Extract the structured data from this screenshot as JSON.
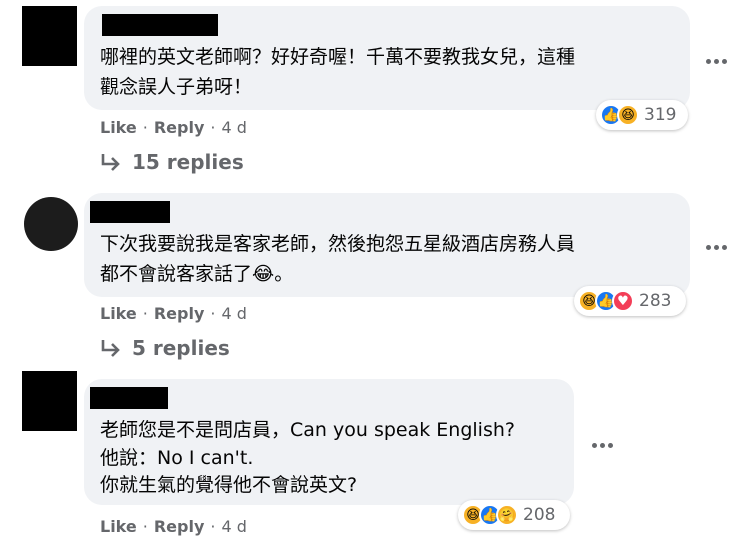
{
  "comments": [
    {
      "lines": [
        "哪裡的英文老師啊？好好奇喔！千萬不要教我女兒，這種",
        "觀念誤人子弟呀！"
      ],
      "reactions": [
        "like",
        "haha"
      ],
      "reaction_count": "319",
      "actions": {
        "like": "Like",
        "reply": "Reply",
        "time": "4 d"
      },
      "replies": "15 replies"
    },
    {
      "lines": [
        "下次我要說我是客家老師，然後抱怨五星級酒店房務人員",
        "都不會說客家話了😂。"
      ],
      "reactions": [
        "haha",
        "like",
        "love"
      ],
      "reaction_count": "283",
      "actions": {
        "like": "Like",
        "reply": "Reply",
        "time": "4 d"
      },
      "replies": "5 replies"
    },
    {
      "lines": [
        "老師您是不是問店員，Can you speak English?",
        "他說：No I can't.",
        "你就生氣的覺得他不會說英文?"
      ],
      "reactions": [
        "haha",
        "like",
        "care"
      ],
      "reaction_count": "208",
      "actions": {
        "like": "Like",
        "reply": "Reply",
        "time": "4 d"
      }
    }
  ],
  "colors": {
    "bubble": "#f0f2f5",
    "like": "#1877f2",
    "haha": "#f7b125",
    "love": "#f33e58",
    "meta": "#65676b"
  },
  "sep": "·"
}
